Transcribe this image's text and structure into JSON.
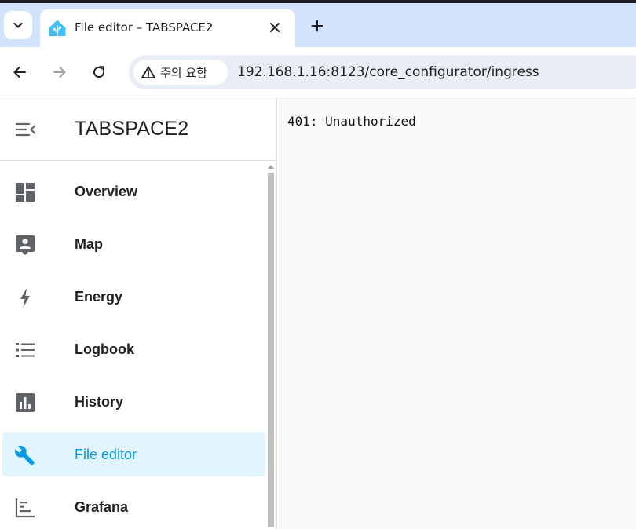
{
  "browser": {
    "tab": {
      "title": "File editor – TABSPACE2"
    },
    "new_tab_label": "+",
    "security_label": "주의 요함",
    "url": "192.168.1.16:8123/core_configurator/ingress"
  },
  "sidebar": {
    "title": "TABSPACE2",
    "items": [
      {
        "label": "Overview",
        "icon": "view-dashboard-icon",
        "active": false
      },
      {
        "label": "Map",
        "icon": "map-account-icon",
        "active": false
      },
      {
        "label": "Energy",
        "icon": "lightning-bolt-icon",
        "active": false
      },
      {
        "label": "Logbook",
        "icon": "format-list-bulleted-icon",
        "active": false
      },
      {
        "label": "History",
        "icon": "chart-box-icon",
        "active": false
      },
      {
        "label": "File editor",
        "icon": "wrench-icon",
        "active": true
      },
      {
        "label": "Grafana",
        "icon": "chart-timeline-icon",
        "active": false
      }
    ],
    "active_color": "#039be5",
    "active_bg": "#e1f5fe"
  },
  "main": {
    "message": "401: Unauthorized"
  }
}
